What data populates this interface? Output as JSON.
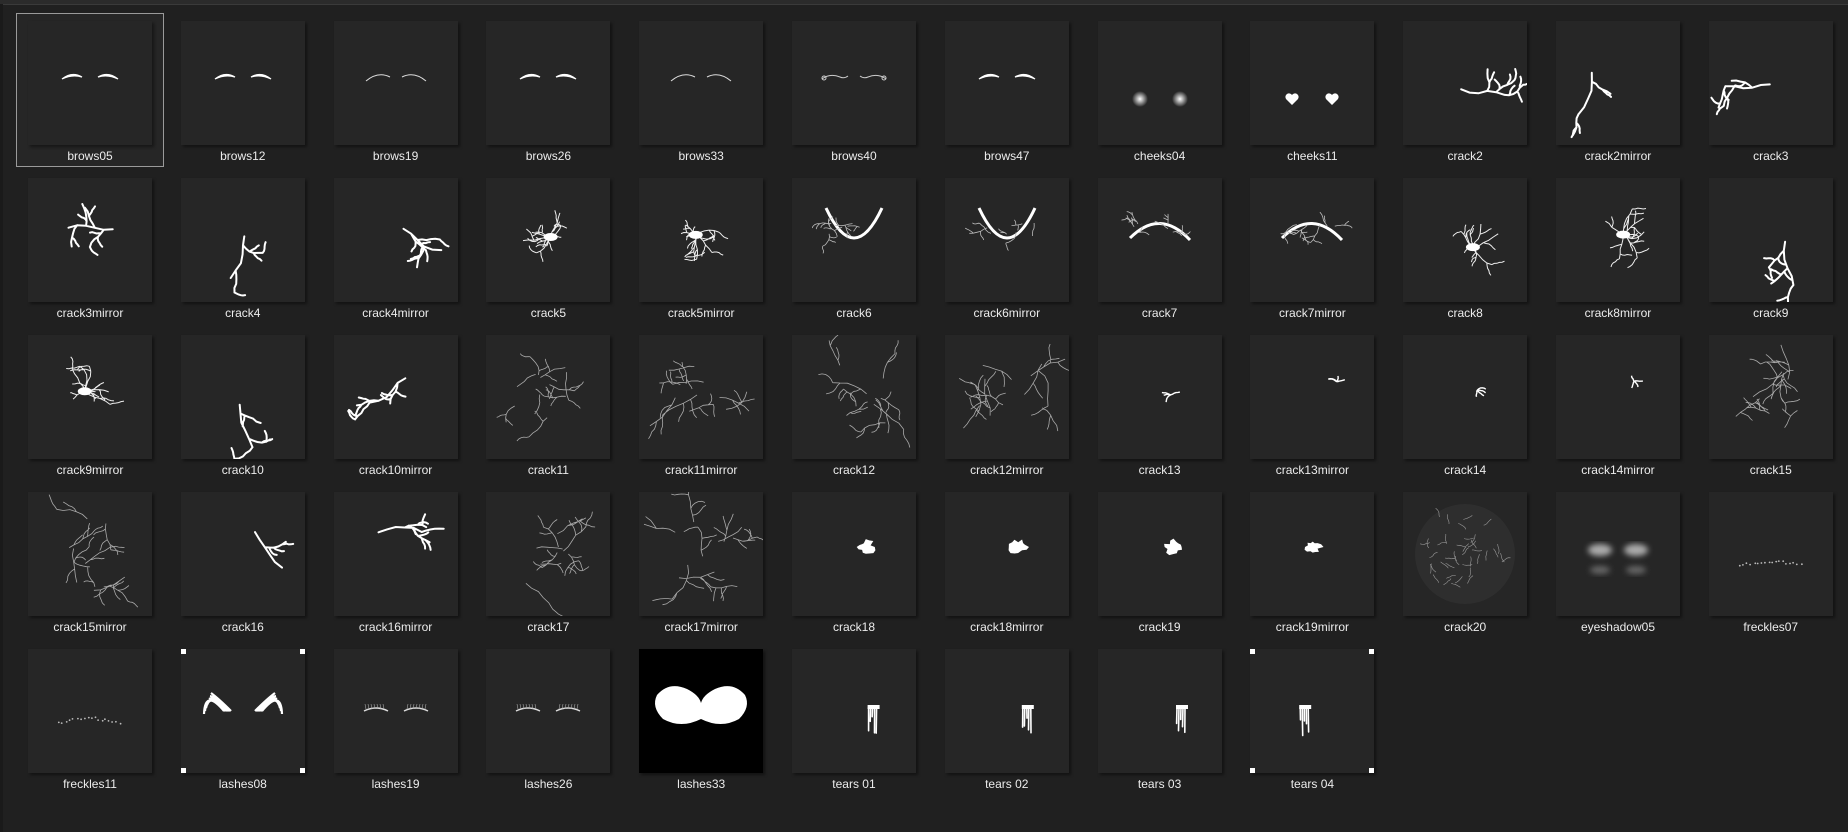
{
  "items": [
    {
      "label": "brows05",
      "art": "brows"
    },
    {
      "label": "brows12",
      "art": "brows"
    },
    {
      "label": "brows19",
      "art": "brows-thin"
    },
    {
      "label": "brows26",
      "art": "brows"
    },
    {
      "label": "brows33",
      "art": "brows-thin"
    },
    {
      "label": "brows40",
      "art": "brows-ornate"
    },
    {
      "label": "brows47",
      "art": "brows"
    },
    {
      "label": "cheeks04",
      "art": "cheeks-blush"
    },
    {
      "label": "cheeks11",
      "art": "cheeks-heart"
    },
    {
      "label": "crack2",
      "art": "crack"
    },
    {
      "label": "crack2mirror",
      "art": "crack"
    },
    {
      "label": "crack3",
      "art": "crack"
    },
    {
      "label": "crack3mirror",
      "art": "crack"
    },
    {
      "label": "crack4",
      "art": "crack"
    },
    {
      "label": "crack4mirror",
      "art": "crack"
    },
    {
      "label": "crack5",
      "art": "crack-burst"
    },
    {
      "label": "crack5mirror",
      "art": "crack-burst"
    },
    {
      "label": "crack6",
      "art": "crack-arc"
    },
    {
      "label": "crack6mirror",
      "art": "crack-arc"
    },
    {
      "label": "crack7",
      "art": "crack-arc"
    },
    {
      "label": "crack7mirror",
      "art": "crack-arc"
    },
    {
      "label": "crack8",
      "art": "crack-burst"
    },
    {
      "label": "crack8mirror",
      "art": "crack-burst"
    },
    {
      "label": "crack9",
      "art": "crack"
    },
    {
      "label": "crack9mirror",
      "art": "crack-burst"
    },
    {
      "label": "crack10",
      "art": "crack"
    },
    {
      "label": "crack10mirror",
      "art": "crack"
    },
    {
      "label": "crack11",
      "art": "crack-web"
    },
    {
      "label": "crack11mirror",
      "art": "crack-web"
    },
    {
      "label": "crack12",
      "art": "crack-web"
    },
    {
      "label": "crack12mirror",
      "art": "crack-web"
    },
    {
      "label": "crack13",
      "art": "crack-small"
    },
    {
      "label": "crack13mirror",
      "art": "crack-small"
    },
    {
      "label": "crack14",
      "art": "crack-small"
    },
    {
      "label": "crack14mirror",
      "art": "crack-small"
    },
    {
      "label": "crack15",
      "art": "crack-web"
    },
    {
      "label": "crack15mirror",
      "art": "crack-web"
    },
    {
      "label": "crack16",
      "art": "crack"
    },
    {
      "label": "crack16mirror",
      "art": "crack"
    },
    {
      "label": "crack17",
      "art": "crack-web"
    },
    {
      "label": "crack17mirror",
      "art": "crack-web"
    },
    {
      "label": "crack18",
      "art": "splat"
    },
    {
      "label": "crack18mirror",
      "art": "splat"
    },
    {
      "label": "crack19",
      "art": "splat"
    },
    {
      "label": "crack19mirror",
      "art": "splat"
    },
    {
      "label": "crack20",
      "art": "crack-sphere"
    },
    {
      "label": "eyeshadow05",
      "art": "eyeshadow"
    },
    {
      "label": "freckles07",
      "art": "freckles"
    },
    {
      "label": "freckles11",
      "art": "freckles"
    },
    {
      "label": "lashes08",
      "art": "lashes-wings"
    },
    {
      "label": "lashes19",
      "art": "lashes"
    },
    {
      "label": "lashes26",
      "art": "lashes"
    },
    {
      "label": "lashes33",
      "art": "lashes-mask"
    },
    {
      "label": "tears 01",
      "art": "tears"
    },
    {
      "label": "tears 02",
      "art": "tears"
    },
    {
      "label": "tears 03",
      "art": "tears"
    },
    {
      "label": "tears 04",
      "art": "tears"
    }
  ],
  "selected_label": "brows05"
}
